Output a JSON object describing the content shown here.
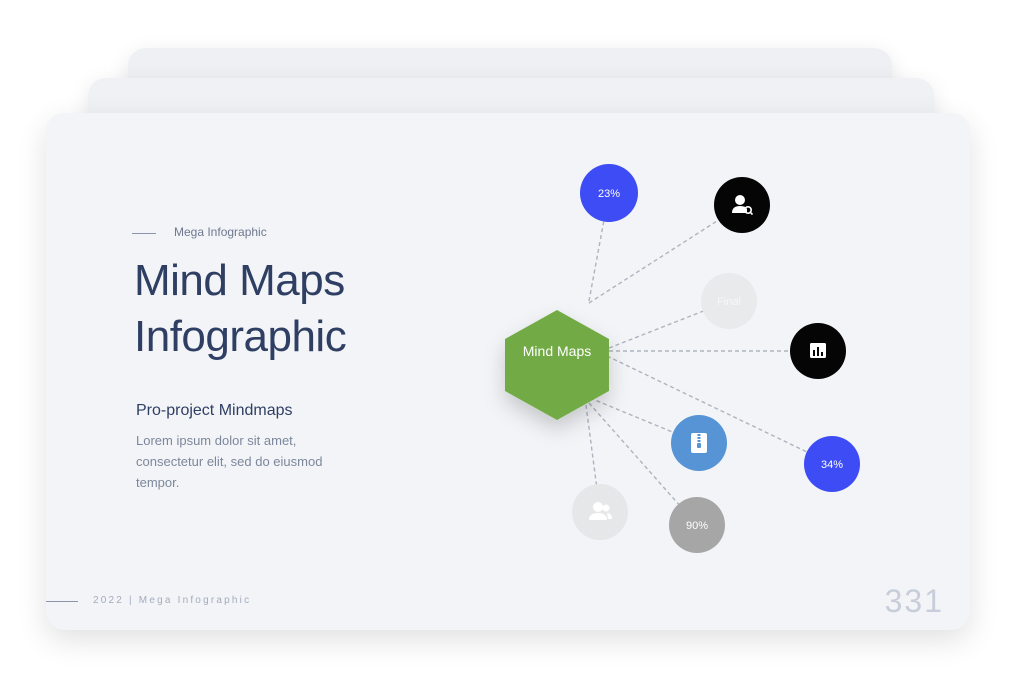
{
  "slide": {
    "eyebrow": "Mega Infographic",
    "title_line1": "Mind Maps",
    "title_line2": "Infographic",
    "subtitle": "Pro-project Mindmaps",
    "body": "Lorem ipsum dolor sit amet, consectetur elit, sed do eiusmod tempor.",
    "footer": "2022 | Mega Infographic",
    "page_number": "331"
  },
  "mindmap": {
    "center": {
      "label": "Mind Maps",
      "color": "#72ab45"
    },
    "nodes": [
      {
        "id": "n1",
        "label": "23%",
        "icon": "",
        "color": "#3d4cf5",
        "text_color": "#ffffff"
      },
      {
        "id": "n2",
        "label": "",
        "icon": "user-search-icon",
        "color": "#050505",
        "text_color": "#ffffff"
      },
      {
        "id": "n3",
        "label": "Final",
        "icon": "",
        "color": "#e9eaec",
        "text_color": "#f7f7f8"
      },
      {
        "id": "n4",
        "label": "",
        "icon": "bar-chart-icon",
        "color": "#050505",
        "text_color": "#ffffff"
      },
      {
        "id": "n5",
        "label": "34%",
        "icon": "",
        "color": "#3d4cf5",
        "text_color": "#ffffff"
      },
      {
        "id": "n6",
        "label": "",
        "icon": "zip-file-icon",
        "color": "#5694d6",
        "text_color": "#ffffff"
      },
      {
        "id": "n7",
        "label": "90%",
        "icon": "",
        "color": "#a6a6a6",
        "text_color": "#ffffff"
      },
      {
        "id": "n8",
        "label": "",
        "icon": "users-icon",
        "color": "#e6e7e9",
        "text_color": "#ffffff"
      }
    ]
  }
}
